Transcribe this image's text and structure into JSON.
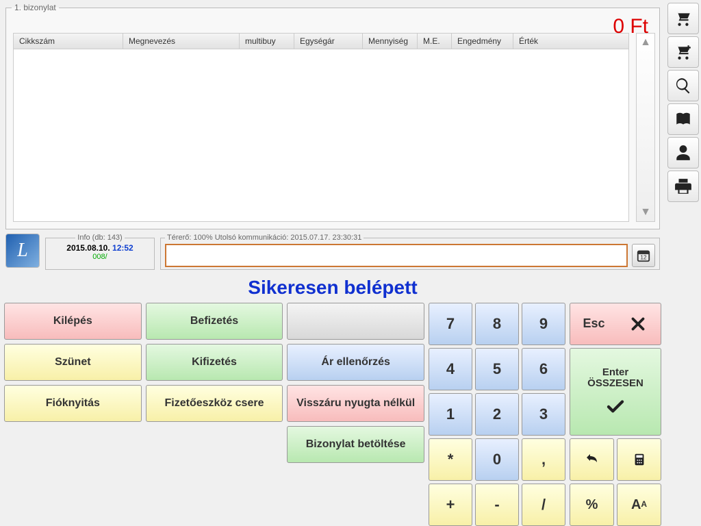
{
  "receipt": {
    "legend": "1. bizonylat",
    "total": "0 Ft",
    "cols": {
      "c1": "Cikkszám",
      "c2": "Megnevezés",
      "c3": "multibuy",
      "c4": "Egységár",
      "c5": "Mennyiség",
      "c6": "M.E.",
      "c7": "Engedmény",
      "c8": "Érték"
    }
  },
  "info": {
    "legend": "Info (db: 143)",
    "date": "2015.08.10.",
    "time": "12:52",
    "ops": "008/"
  },
  "terer": {
    "legend": "Térerő: 100%  Utolsó kommunikáció: 2015.07.17. 23:30:31"
  },
  "status": "Sikeresen belépett",
  "actions": {
    "kilepes": "Kilépés",
    "befizetes": "Befizetés",
    "szunet": "Szünet",
    "kifizetes": "Kifizetés",
    "arellen": "Ár ellenőrzés",
    "fiok": "Fióknyitás",
    "fizcsere": "Fizetőeszköz csere",
    "visszaru": "Visszáru nyugta nélkül",
    "bizbe": "Bizonylat betöltése"
  },
  "keys": {
    "k7": "7",
    "k8": "8",
    "k9": "9",
    "k4": "4",
    "k5": "5",
    "k6": "6",
    "k1": "1",
    "k2": "2",
    "k3": "3",
    "star": "*",
    "k0": "0",
    "comma": ",",
    "plus": "+",
    "minus": "-",
    "slash": "/"
  },
  "right": {
    "esc": "Esc",
    "enter1": "Enter",
    "enter2": "ÖSSZESEN",
    "pct": "%",
    "aa": "A",
    "aasmall": "A"
  },
  "cal": "12"
}
